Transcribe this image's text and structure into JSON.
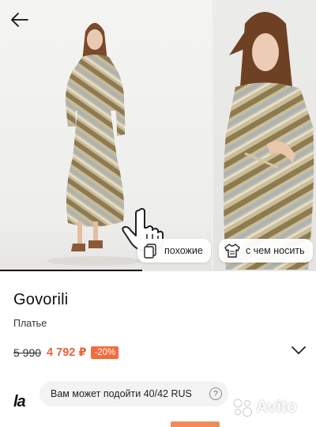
{
  "product": {
    "brand": "Govorili",
    "category": "Платье",
    "old_price": "5 990",
    "new_price": "4 792 ₽",
    "discount": "-20%"
  },
  "gallery": {
    "similar_label": "похожие",
    "wear_with_label": "с чем носить",
    "progress_fraction": 0.45,
    "dress_colors": [
      "#c4b08a",
      "#8b7b55",
      "#a8b3b8",
      "#d9d5c6"
    ]
  },
  "store": {
    "logo_text": "la",
    "size_hint": "Вам может подойти 40/42 RUS",
    "help_symbol": "?"
  },
  "watermark": {
    "text": "Avito"
  },
  "icons": [
    "back-arrow-icon",
    "swipe-hand-icon",
    "similar-cards-icon",
    "hanger-shirt-icon",
    "chevron-down-icon",
    "question-icon"
  ]
}
